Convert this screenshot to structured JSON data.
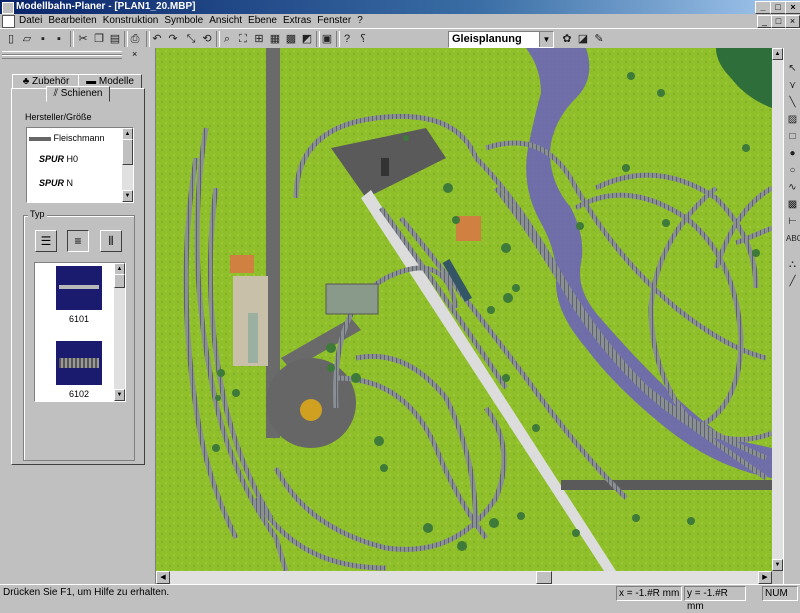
{
  "window": {
    "title": "Modellbahn-Planer - [PLAN1_20.MBP]",
    "min_glyph": "_",
    "max_glyph": "□",
    "close_glyph": "×"
  },
  "menu": {
    "items": [
      "Datei",
      "Bearbeiten",
      "Konstruktion",
      "Symbole",
      "Ansicht",
      "Ebene",
      "Extras",
      "Fenster",
      "?"
    ]
  },
  "toolbar": {
    "icons": [
      "new-icon",
      "open-icon",
      "save-icon",
      "save-all-icon",
      "cut-icon",
      "copy-icon",
      "paste-icon",
      "print-icon",
      "undo-icon",
      "redo-icon",
      "zoom-icon",
      "zoom-fit-icon",
      "zoom-window-icon",
      "zoom-in-icon",
      "zoom-out-icon",
      "grid-icon",
      "layer-icon",
      "layout-icon",
      "tool-icon",
      "help-icon",
      "context-help-icon"
    ],
    "mode_value": "Gleisplanung"
  },
  "panel": {
    "tabs": [
      "Zubehör",
      "Modelle",
      "Schienen"
    ],
    "manufacturer_label": "Hersteller/Größe",
    "manufacturers": [
      {
        "name": "Fleischmann"
      },
      {
        "badge": "SPUR",
        "name": "H0"
      },
      {
        "badge": "SPUR",
        "name": "N"
      }
    ],
    "type_label": "Typ",
    "products": [
      "6101",
      "6102"
    ]
  },
  "status": {
    "help_text": "Drücken Sie F1, um Hilfe zu erhalten.",
    "x_text": "x = -1.#R mm",
    "y_text": "y = -1.#R mm",
    "num_text": "NUM"
  },
  "colors": {
    "title_bar": "#0a246a",
    "grass": "#8fbf2a",
    "water": "#6a5fc0",
    "track": "#8a8f96",
    "road": "#6a6a6a"
  }
}
